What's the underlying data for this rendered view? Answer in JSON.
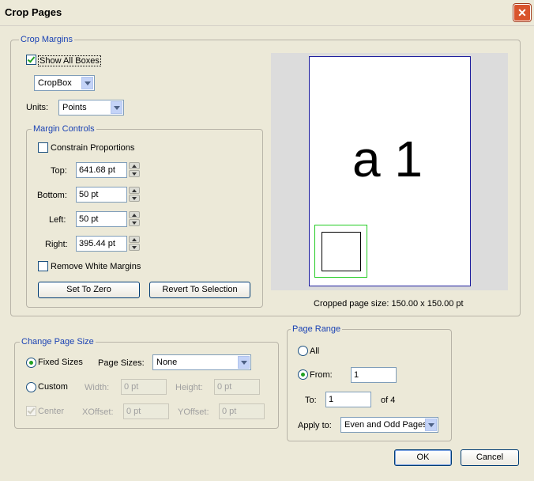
{
  "window": {
    "title": "Crop Pages"
  },
  "crop_margins": {
    "legend": "Crop Margins",
    "show_all_boxes": "Show All Boxes",
    "box_select": "CropBox",
    "units_label": "Units:",
    "units_value": "Points",
    "margin_controls": {
      "legend": "Margin Controls",
      "constrain": "Constrain Proportions",
      "top_label": "Top:",
      "top_value": "641.68 pt",
      "bottom_label": "Bottom:",
      "bottom_value": "50 pt",
      "left_label": "Left:",
      "left_value": "50 pt",
      "right_label": "Right:",
      "right_value": "395.44 pt",
      "remove_white": "Remove White Margins",
      "set_zero": "Set To Zero",
      "revert": "Revert To Selection"
    }
  },
  "preview": {
    "page_text": "a 1",
    "cropped_size": "Cropped page size: 150.00 x 150.00 pt"
  },
  "change_page_size": {
    "legend": "Change Page Size",
    "fixed_sizes": "Fixed Sizes",
    "page_sizes_label": "Page Sizes:",
    "page_sizes_value": "None",
    "custom": "Custom",
    "width_label": "Width:",
    "width_value": "0 pt",
    "height_label": "Height:",
    "height_value": "0 pt",
    "center": "Center",
    "xoffset_label": "XOffset:",
    "xoffset_value": "0 pt",
    "yoffset_label": "YOffset:",
    "yoffset_value": "0 pt"
  },
  "page_range": {
    "legend": "Page Range",
    "all": "All",
    "from": "From:",
    "from_value": "1",
    "to": "To:",
    "to_value": "1",
    "of_pages": "of 4",
    "apply_to_label": "Apply to:",
    "apply_to_value": "Even and Odd Pages"
  },
  "buttons": {
    "ok": "OK",
    "cancel": "Cancel"
  }
}
